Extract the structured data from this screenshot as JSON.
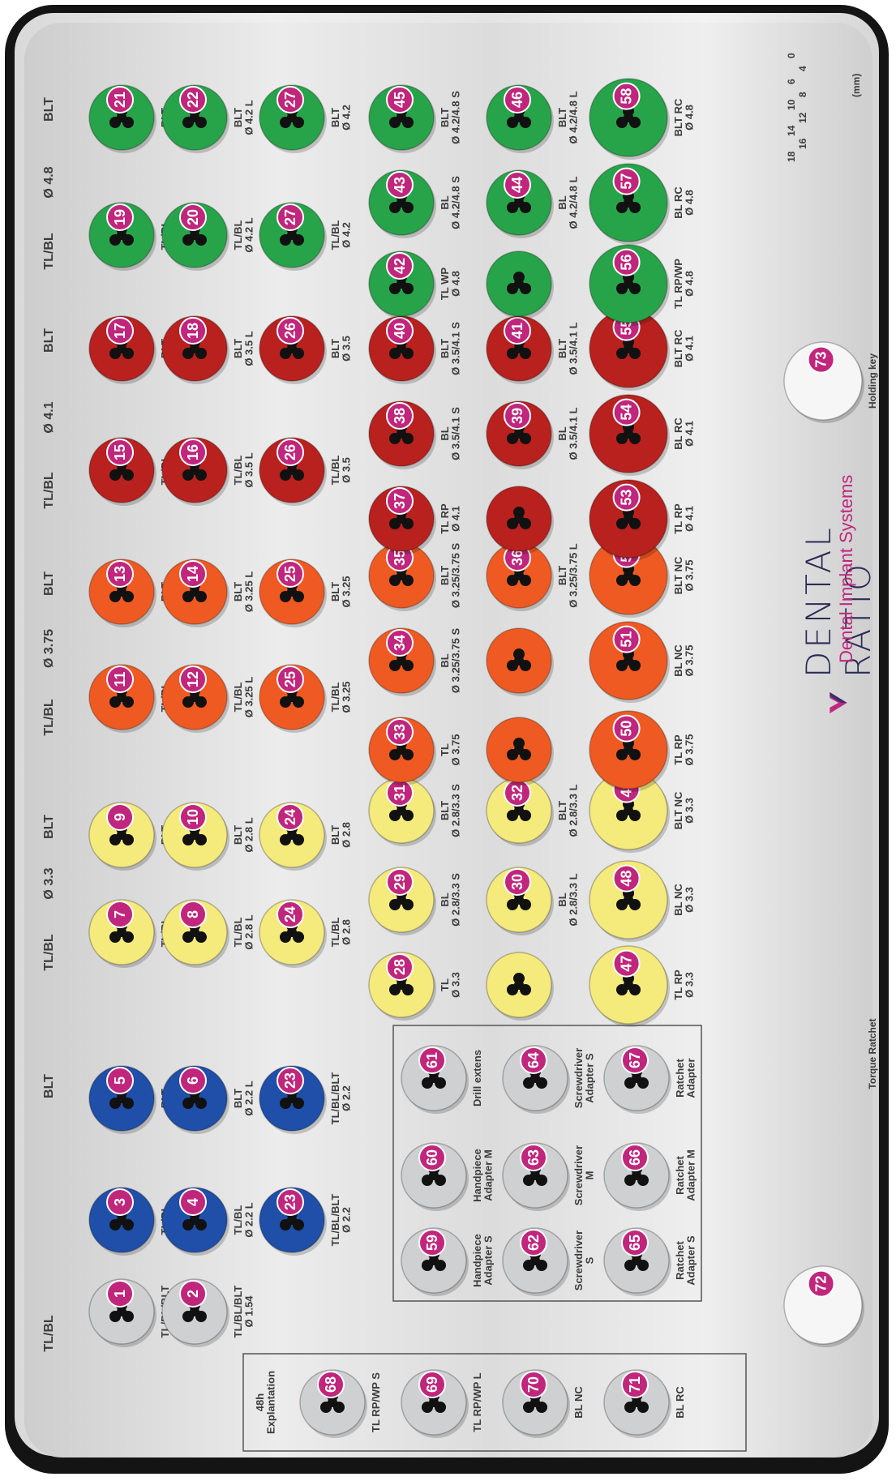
{
  "brand": {
    "name": "DENTAL RATIO",
    "subtitle": "Dental Implant Systems"
  },
  "headers": {
    "g1_tlbl": "TL/BL",
    "g1_blt": "BLT",
    "g2_tlbl": "TL/BL",
    "g2_dia": "Ø 3.3",
    "g2_blt": "BLT",
    "g3_tlbl": "TL/BL",
    "g3_dia": "Ø 3.75",
    "g3_blt": "BLT",
    "g4_tlbl": "TL/BL",
    "g4_dia": "Ø 4.1",
    "g4_blt": "BLT",
    "g5_tlbl": "TL/BL",
    "g5_dia": "Ø 4.8",
    "g5_blt": "BLT"
  },
  "colors": {
    "gray": "#cfd0d2",
    "blue": "#1f4fa8",
    "yellow": "#f5ea7c",
    "orange": "#ef5a22",
    "red": "#b8211e",
    "green": "#27a34a",
    "badge": "#c0267c"
  },
  "labels": {
    "explantation": "48h\nExplantation",
    "holding_key": "Holding key",
    "torque_ratchet": "Torque Ratchet",
    "mm": "(mm)",
    "ruler": [
      "18",
      "16",
      "14",
      "12",
      "10",
      "8",
      "6",
      "4",
      "0"
    ]
  },
  "slots": [
    {
      "n": "1",
      "color": "gray",
      "label": "TL/BL/BLT\nØ 2.2"
    },
    {
      "n": "2",
      "color": "gray",
      "label": "TL/BL/BLT\nØ 1.54"
    },
    {
      "n": "3",
      "color": "blue",
      "label": "TL/BL\nØ 2.2 S"
    },
    {
      "n": "4",
      "color": "blue",
      "label": "TL/BL\nØ 2.2 L"
    },
    {
      "n": "5",
      "color": "blue",
      "label": "BLT\nØ 2.2 S"
    },
    {
      "n": "6",
      "color": "blue",
      "label": "BLT\nØ 2.2 L"
    },
    {
      "n": "23",
      "color": "blue",
      "label": "TL/BL/BLT\nØ 2.2"
    },
    {
      "n": "23",
      "color": "blue",
      "label": "TL/BL/BLT\nØ 2.2"
    },
    {
      "n": "7",
      "color": "yellow",
      "label": "TL/BL\nØ 2.8 S"
    },
    {
      "n": "8",
      "color": "yellow",
      "label": "TL/BL\nØ 2.8 L"
    },
    {
      "n": "9",
      "color": "yellow",
      "label": "BLT\nØ 2.8 S"
    },
    {
      "n": "10",
      "color": "yellow",
      "label": "BLT\nØ 2.8 L"
    },
    {
      "n": "24",
      "color": "yellow",
      "label": "TL/BL\nØ 2.8"
    },
    {
      "n": "24",
      "color": "yellow",
      "label": "BLT\nØ 2.8"
    },
    {
      "n": "28",
      "color": "yellow",
      "label": "TL\nØ 3.3"
    },
    {
      "n": "",
      "color": "yellow",
      "label": ""
    },
    {
      "n": "47",
      "color": "yellow",
      "label": "TL RP\nØ 3.3"
    },
    {
      "n": "29",
      "color": "yellow",
      "label": "BL\nØ 2.8/3.3 S"
    },
    {
      "n": "30",
      "color": "yellow",
      "label": "BL\nØ 2.8/3.3 L"
    },
    {
      "n": "48",
      "color": "yellow",
      "label": "BL NC\nØ 3.3"
    },
    {
      "n": "31",
      "color": "yellow",
      "label": "BLT\nØ 2.8/3.3 S"
    },
    {
      "n": "32",
      "color": "yellow",
      "label": "BLT\nØ 2.8/3.3 L"
    },
    {
      "n": "49",
      "color": "yellow",
      "label": "BLT NC\nØ 3.3"
    },
    {
      "n": "11",
      "color": "orange",
      "label": "TL/BL\nØ 3.25 S"
    },
    {
      "n": "12",
      "color": "orange",
      "label": "TL/BL\nØ 3.25 L"
    },
    {
      "n": "13",
      "color": "orange",
      "label": "BLT\nØ 3.25 S"
    },
    {
      "n": "14",
      "color": "orange",
      "label": "BLT\nØ 3.25 L"
    },
    {
      "n": "25",
      "color": "orange",
      "label": "TL/BL\nØ 3.25"
    },
    {
      "n": "25",
      "color": "orange",
      "label": "BLT\nØ 3.25"
    },
    {
      "n": "33",
      "color": "orange",
      "label": "TL\nØ 3.75"
    },
    {
      "n": "",
      "color": "orange",
      "label": ""
    },
    {
      "n": "50",
      "color": "orange",
      "label": "TL RP\nØ 3.75"
    },
    {
      "n": "34",
      "color": "orange",
      "label": "BL\nØ 3.25/3.75 S"
    },
    {
      "n": "",
      "color": "orange",
      "label": ""
    },
    {
      "n": "51",
      "color": "orange",
      "label": "BL NC\nØ 3.75"
    },
    {
      "n": "35",
      "color": "orange",
      "label": "BLT\nØ 3.25/3.75 S"
    },
    {
      "n": "36",
      "color": "orange",
      "label": "BLT\nØ 3.25/3.75 L"
    },
    {
      "n": "52",
      "color": "orange",
      "label": "BLT NC\nØ 3.75"
    },
    {
      "n": "15",
      "color": "red",
      "label": "TL/BL\nØ 3.5 S"
    },
    {
      "n": "16",
      "color": "red",
      "label": "TL/BL\nØ 3.5 L"
    },
    {
      "n": "17",
      "color": "red",
      "label": "BLT\nØ 3.5 S"
    },
    {
      "n": "18",
      "color": "red",
      "label": "BLT\nØ 3.5 L"
    },
    {
      "n": "26",
      "color": "red",
      "label": "TL/BL\nØ 3.5"
    },
    {
      "n": "26",
      "color": "red",
      "label": "BLT\nØ 3.5"
    },
    {
      "n": "37",
      "color": "red",
      "label": "TL RP\nØ 4.1"
    },
    {
      "n": "",
      "color": "red",
      "label": ""
    },
    {
      "n": "53",
      "color": "red",
      "label": "TL RP\nØ 4.1"
    },
    {
      "n": "38",
      "color": "red",
      "label": "BL\nØ 3.5/4.1 S"
    },
    {
      "n": "39",
      "color": "red",
      "label": "BL\nØ 3.5/4.1 L"
    },
    {
      "n": "54",
      "color": "red",
      "label": "BL RC\nØ 4.1"
    },
    {
      "n": "40",
      "color": "red",
      "label": "BLT\nØ 3.5/4.1 S"
    },
    {
      "n": "41",
      "color": "red",
      "label": "BLT\nØ 3.5/4.1 L"
    },
    {
      "n": "55",
      "color": "red",
      "label": "BLT RC\nØ 4.1"
    },
    {
      "n": "19",
      "color": "green",
      "label": "TL/BL\nØ 4.2 S"
    },
    {
      "n": "20",
      "color": "green",
      "label": "TL/BL\nØ 4.2 L"
    },
    {
      "n": "21",
      "color": "green",
      "label": "BLT\nØ 4.2 S"
    },
    {
      "n": "22",
      "color": "green",
      "label": "BLT\nØ 4.2 L"
    },
    {
      "n": "27",
      "color": "green",
      "label": "TL/BL\nØ 4.2"
    },
    {
      "n": "27",
      "color": "green",
      "label": "BLT\nØ 4.2"
    },
    {
      "n": "42",
      "color": "green",
      "label": "TL WP\nØ 4.8"
    },
    {
      "n": "",
      "color": "green",
      "label": ""
    },
    {
      "n": "56",
      "color": "green",
      "label": "TL RP/WP\nØ 4.8"
    },
    {
      "n": "43",
      "color": "green",
      "label": "BL\nØ 4.2/4.8 S"
    },
    {
      "n": "44",
      "color": "green",
      "label": "BL\nØ 4.2/4.8 L"
    },
    {
      "n": "57",
      "color": "green",
      "label": "BL RC\nØ 4.8"
    },
    {
      "n": "45",
      "color": "green",
      "label": "BLT\nØ 4.2/4.8 S"
    },
    {
      "n": "46",
      "color": "green",
      "label": "BLT\nØ 4.2/4.8 L"
    },
    {
      "n": "58",
      "color": "green",
      "label": "BLT RC\nØ 4.8"
    },
    {
      "n": "59",
      "color": "gray",
      "label": "Handpiece\nAdapter S"
    },
    {
      "n": "60",
      "color": "gray",
      "label": "Handpiece\nAdapter M"
    },
    {
      "n": "61",
      "color": "gray",
      "label": "Drill extens"
    },
    {
      "n": "62",
      "color": "gray",
      "label": "Screwdriver\nS"
    },
    {
      "n": "63",
      "color": "gray",
      "label": "Screwdriver\nM"
    },
    {
      "n": "64",
      "color": "gray",
      "label": "Screwdriver\nAdapter S"
    },
    {
      "n": "65",
      "color": "gray",
      "label": "Ratchet\nAdapter S"
    },
    {
      "n": "66",
      "color": "gray",
      "label": "Ratchet\nAdapter M"
    },
    {
      "n": "67",
      "color": "gray",
      "label": "Ratchet\nAdapter"
    },
    {
      "n": "68",
      "color": "gray",
      "label": "TL RP/WP S"
    },
    {
      "n": "69",
      "color": "gray",
      "label": "TL RP/WP L"
    },
    {
      "n": "70",
      "color": "gray",
      "label": "BL NC"
    },
    {
      "n": "71",
      "color": "gray",
      "label": "BL RC"
    },
    {
      "n": "72",
      "color": "white",
      "label": ""
    },
    {
      "n": "73",
      "color": "white",
      "label": ""
    }
  ]
}
